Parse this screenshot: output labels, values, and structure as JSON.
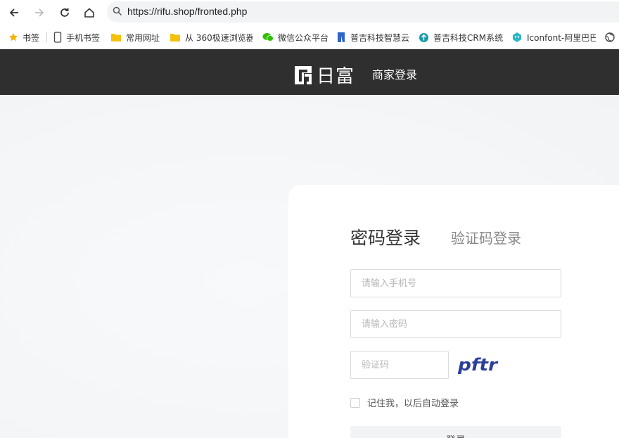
{
  "browser": {
    "url": "https://rifu.shop/fronted.php",
    "bookmarks": [
      {
        "label": "书签",
        "icon": "star-icon"
      },
      {
        "label": "手机书签",
        "icon": "phone-icon"
      },
      {
        "label": "常用网址",
        "icon": "folder-icon"
      },
      {
        "label": "从 360极速浏览器",
        "icon": "folder-icon"
      },
      {
        "label": "微信公众平台",
        "icon": "wechat-icon"
      },
      {
        "label": "普吉科技智慧云",
        "icon": "puji-logo-icon"
      },
      {
        "label": "普吉科技CRM系统",
        "icon": "crm-icon"
      },
      {
        "label": "Iconfont-阿里巴巴",
        "icon": "iconfont-icon"
      },
      {
        "label": "",
        "icon": "globe-icon"
      }
    ],
    "colors": {
      "star": "#f5b400",
      "folder": "#f4c20d",
      "wechat": "#2dc100",
      "puji": "#2f64c8",
      "crm": "#1a9aa6",
      "iconfont": "#28b8c8"
    }
  },
  "header": {
    "logo_text": "日富",
    "title": "商家登录",
    "bg_color": "#2f2f2f"
  },
  "login": {
    "tab_password": "密码登录",
    "tab_code": "验证码登录",
    "phone_placeholder": "请输入手机号",
    "password_placeholder": "请输入密码",
    "code_placeholder": "验证码",
    "captcha_text": "pftr",
    "captcha_color": "#2b3f9a",
    "remember_label": "记住我，以后自动登录",
    "submit_label": "登录"
  }
}
